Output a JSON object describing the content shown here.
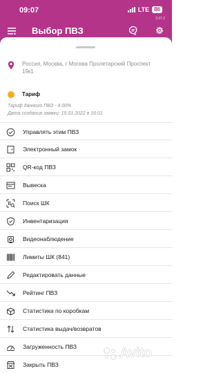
{
  "status_bar": {
    "time": "09:07",
    "network": "LTE",
    "battery": "86"
  },
  "app": {
    "version": "3.37.2",
    "title": "Выбор ПВЗ"
  },
  "pvz": {
    "address": "Россия, Москва, г Москва Пролетарский Проспект 19к1",
    "tariff_title": "Тариф",
    "tariff_line": "Тариф данного ПВЗ - 4.00%",
    "application_date_line": "Дата создания заявки: 15.01.2022 в 16:01"
  },
  "menu": [
    {
      "label": "Управлять этим ПВЗ",
      "icon": "check-circle-icon"
    },
    {
      "label": "Электронный замок",
      "icon": "door-lock-icon"
    },
    {
      "label": "QR-код ПВЗ",
      "icon": "qr-code-icon"
    },
    {
      "label": "Вывеска",
      "icon": "signboard-icon"
    },
    {
      "label": "Поиск ШК",
      "icon": "barcode-search-icon"
    },
    {
      "label": "Инвентаризация",
      "icon": "inventory-shield-icon"
    },
    {
      "label": "Видеонаблюдение",
      "icon": "camera-icon"
    },
    {
      "label": "Лимиты ШК (841)",
      "icon": "barcode-icon"
    },
    {
      "label": "Редактировать данные",
      "icon": "pencil-icon"
    },
    {
      "label": "Рейтинг ПВЗ",
      "icon": "trend-icon"
    },
    {
      "label": "Статистика по коробкам",
      "icon": "box-stats-icon"
    },
    {
      "label": "Статистика выдач/возвратов",
      "icon": "swap-arrows-icon"
    },
    {
      "label": "Загруженность ПВЗ",
      "icon": "load-gauge-icon"
    },
    {
      "label": "Закрыть ПВЗ",
      "icon": "close-store-icon"
    }
  ],
  "watermark": "Avito",
  "colors": {
    "accent": "#b4348a",
    "pin": "#b4348a",
    "tariff": "#f2b01e",
    "text": "#1c1c1e",
    "muted": "#8e8e93"
  }
}
